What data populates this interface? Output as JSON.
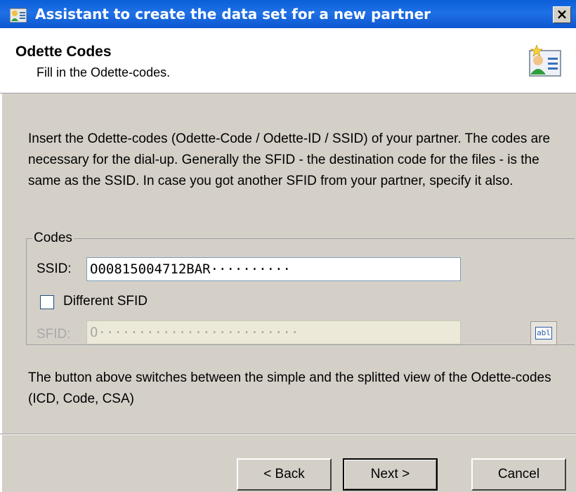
{
  "window": {
    "title": "Assistant to create the data set for a new partner",
    "close_label": "×"
  },
  "header": {
    "title": "Odette Codes",
    "subtitle": "Fill in the Odette-codes."
  },
  "intro_text": "Insert the Odette-codes (Odette-Code / Odette-ID / SSID) of your partner. The codes are necessary for the dial-up. Generally the SFID - the destination code for the files - is the same as the SSID. In case you got another SFID from your partner, specify it also.",
  "codes_group": {
    "legend": "Codes",
    "ssid_label": "SSID:",
    "ssid_value": "O00815004712BAR··········",
    "different_sfid_label": "Different SFID",
    "different_sfid_checked": false,
    "sfid_label": "SFID:",
    "sfid_value": "O·························",
    "view_toggle_icon": "abl",
    "view_toggle_icon_name": "text-field-icon"
  },
  "note_text": "The button above switches between the simple and the splitted view of the Odette-codes (ICD, Code, CSA)",
  "buttons": {
    "back": "< Back",
    "next": "Next >",
    "cancel": "Cancel"
  },
  "colors": {
    "titlebar": "#0a5fd8",
    "dialog_bg": "#d4d0c8",
    "header_bg": "#ffffff"
  }
}
